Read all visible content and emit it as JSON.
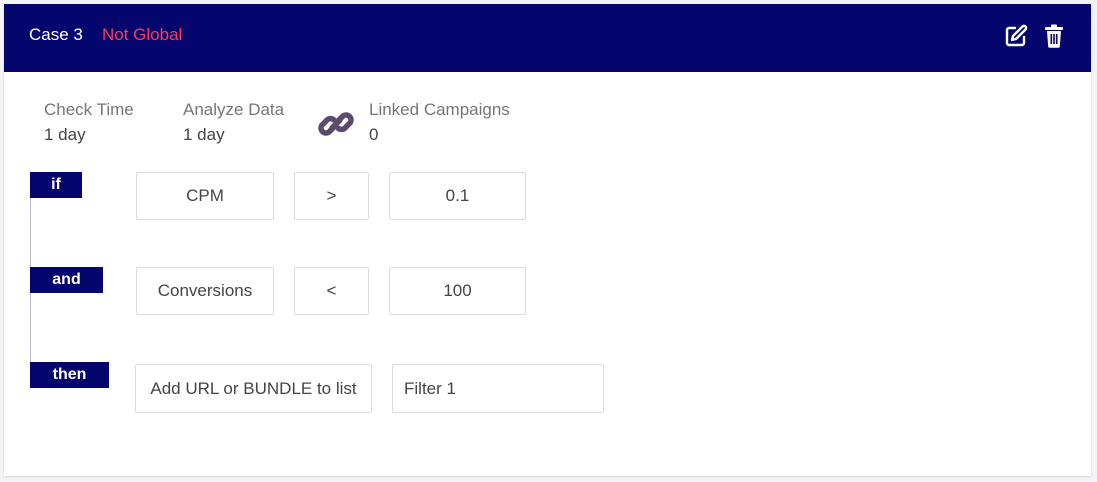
{
  "header": {
    "title": "Case 3",
    "status": "Not Global",
    "status_color": "#ff3b5c",
    "bg_color": "#05056e",
    "icons": [
      "edit-icon",
      "trash-icon"
    ]
  },
  "info": {
    "check_time": {
      "label": "Check Time",
      "value": "1 day"
    },
    "analyze_data": {
      "label": "Analyze Data",
      "value": "1 day"
    },
    "linked_campaigns": {
      "label": "Linked Campaigns",
      "value": "0",
      "icon": "link-icon",
      "icon_color": "#5c4a6e"
    }
  },
  "rules": {
    "if": {
      "keyword": "if",
      "metric": "CPM",
      "operator": ">",
      "value": "0.1"
    },
    "and": {
      "keyword": "and",
      "metric": "Conversions",
      "operator": "<",
      "value": "100"
    },
    "then": {
      "keyword": "then",
      "action": "Add URL or BUNDLE to list",
      "target": "Filter 1"
    }
  }
}
